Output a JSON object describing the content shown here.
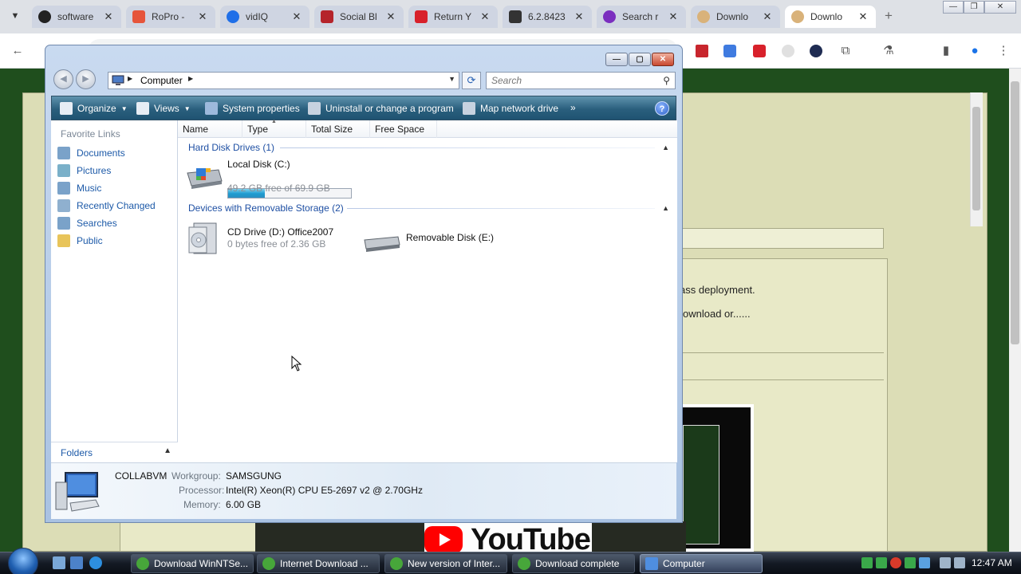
{
  "browser": {
    "tabs": [
      {
        "title": "software",
        "favicon": "github-icon",
        "active": false
      },
      {
        "title": "RoPro - ",
        "favicon": "ropro-icon",
        "active": false
      },
      {
        "title": "vidIQ",
        "favicon": "vidiq-icon",
        "active": false
      },
      {
        "title": "Social Bl",
        "favicon": "socialblade-icon",
        "active": false
      },
      {
        "title": "Return Y",
        "favicon": "return-dislike-icon",
        "active": false
      },
      {
        "title": "6.2.8423",
        "favicon": "archive-icon",
        "active": false
      },
      {
        "title": "Search r",
        "favicon": "search-engine-icon",
        "active": false
      },
      {
        "title": "Downlo",
        "favicon": "download-site-icon",
        "active": false
      },
      {
        "title": "Downlo",
        "favicon": "download-site-icon",
        "active": true
      }
    ]
  },
  "webpage": {
    "text_1": "ass deployment.",
    "text_2": "ownload or......",
    "youtube": "YouTube"
  },
  "explorer": {
    "address": "Computer",
    "search_placeholder": "Search",
    "commands": {
      "organize": "Organize",
      "views": "Views",
      "system_properties": "System properties",
      "uninstall": "Uninstall or change a program",
      "map_drive": "Map network drive",
      "more": "»"
    },
    "help": "?",
    "favorite_links_heading": "Favorite Links",
    "favorite_links": [
      "Documents",
      "Pictures",
      "Music",
      "Recently Changed",
      "Searches",
      "Public"
    ],
    "folders_label": "Folders",
    "columns": [
      "Name",
      "Type",
      "Total Size",
      "Free Space"
    ],
    "groups": {
      "hard_disk": "Hard Disk Drives (1)",
      "removable": "Devices with Removable Storage (2)"
    },
    "drives": {
      "c_name": "Local Disk (C:)",
      "c_free": "49.2 GB free of 69.9 GB",
      "c_used_fraction": 0.296,
      "d_name": "CD Drive (D:) Office2007",
      "d_free": "0 bytes free of 2.36 GB",
      "e_name": "Removable Disk (E:)"
    },
    "details": {
      "computer_name": "COLLABVM",
      "workgroup_label": "Workgroup:",
      "workgroup": "SAMSGUNG",
      "processor_label": "Processor:",
      "processor": "Intel(R) Xeon(R) CPU E5-2697 v2 @ 2.70GHz",
      "memory_label": "Memory:",
      "memory": "6.00 GB"
    }
  },
  "taskbar": {
    "tasks": [
      {
        "label": "Download WinNTSe...",
        "active": false
      },
      {
        "label": "Internet Download ...",
        "active": false
      },
      {
        "label": "New version of Inter...",
        "active": false
      },
      {
        "label": "Download complete",
        "active": false
      },
      {
        "label": "Computer",
        "active": true
      }
    ],
    "clock": "12:47 AM"
  },
  "colors": {
    "link_blue": "#1d5aa8",
    "group_blue": "#1e4fa3",
    "page_green": "#1f4e1d",
    "page_tan": "#dcddb6",
    "command_bar": "#2a5f7d"
  }
}
